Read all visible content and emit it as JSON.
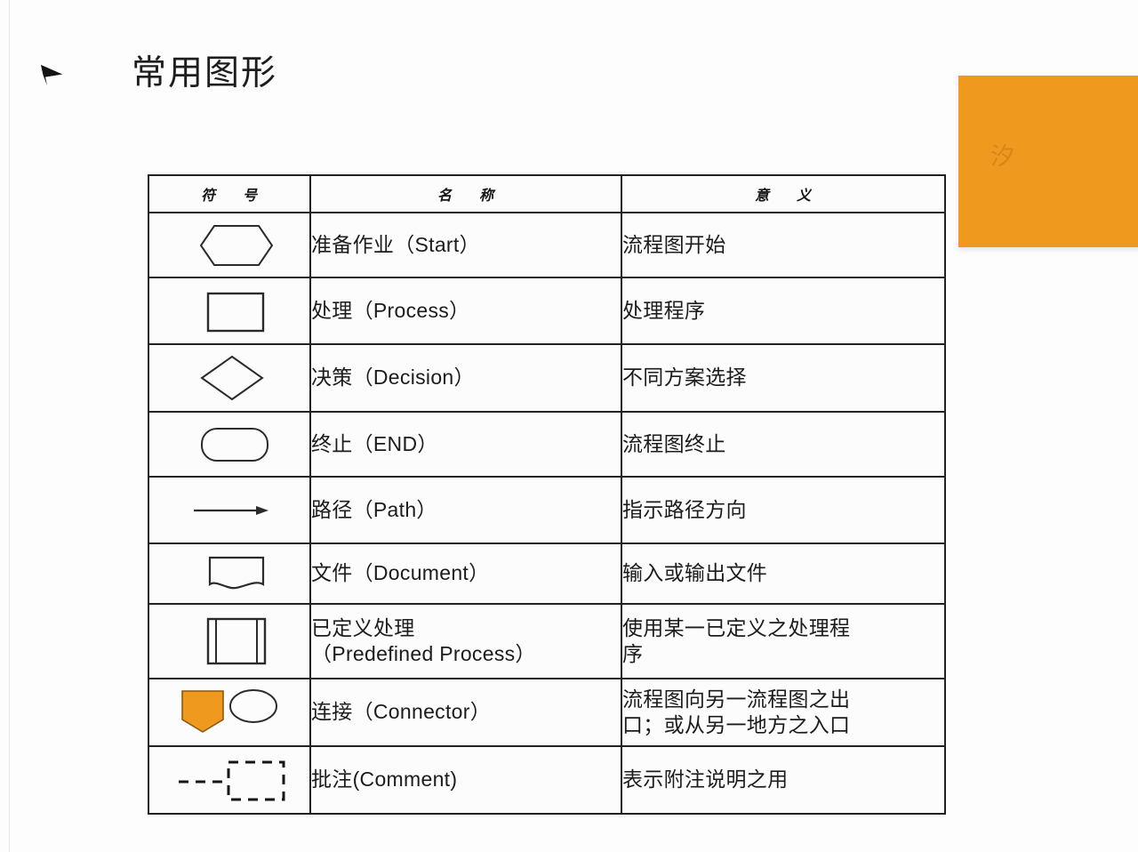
{
  "slide": {
    "background_color": "#fdfdfd",
    "title": "常用图形",
    "bullet_icon": "arrow-bullet-icon"
  },
  "decoration": {
    "orange_block_color": "#ef9a1e",
    "orange_glyph": "汐"
  },
  "table": {
    "headers": [
      {
        "text_left": "符",
        "text_right": "号",
        "name": "symbol"
      },
      {
        "text_left": "名",
        "text_right": "称",
        "name": "name"
      },
      {
        "text_left": "意",
        "text_right": "义",
        "name": "meaning"
      }
    ],
    "rows": [
      {
        "symbol_icon": "hexagon-start-shape-icon",
        "name": "准备作业（Start）",
        "name_line2": "",
        "meaning_line1": "流程图开始",
        "meaning_line2": ""
      },
      {
        "symbol_icon": "rectangle-process-shape-icon",
        "name": "处理（Process）",
        "name_line2": "",
        "meaning_line1": "处理程序",
        "meaning_line2": ""
      },
      {
        "symbol_icon": "diamond-decision-shape-icon",
        "name": "决策（Decision）",
        "name_line2": "",
        "meaning_line1": "不同方案选择",
        "meaning_line2": ""
      },
      {
        "symbol_icon": "rounded-terminator-shape-icon",
        "name": "终止（END）",
        "name_line2": "",
        "meaning_line1": "流程图终止",
        "meaning_line2": ""
      },
      {
        "symbol_icon": "arrow-path-shape-icon",
        "name": "路径（Path）",
        "name_line2": "",
        "meaning_line1": "指示路径方向",
        "meaning_line2": ""
      },
      {
        "symbol_icon": "document-wavy-shape-icon",
        "name": "文件（Document）",
        "name_line2": "",
        "meaning_line1": "输入或输出文件",
        "meaning_line2": ""
      },
      {
        "symbol_icon": "predefined-process-shape-icon",
        "name": "已定义处理",
        "name_line2": "（Predefined Process）",
        "meaning_line1": "使用某一已定义之处理程",
        "meaning_line2": "序"
      },
      {
        "symbol_icon": "connector-shield-and-circle-shape-icon",
        "name": "连接（Connector）",
        "name_line2": "",
        "meaning_line1": "流程图向另一流程图之出",
        "meaning_line2": "口；或从另一地方之入口"
      },
      {
        "symbol_icon": "dashed-comment-shape-icon",
        "name": "批注(Comment)",
        "name_line2": "",
        "meaning_line1": "表示附注说明之用",
        "meaning_line2": ""
      }
    ]
  }
}
